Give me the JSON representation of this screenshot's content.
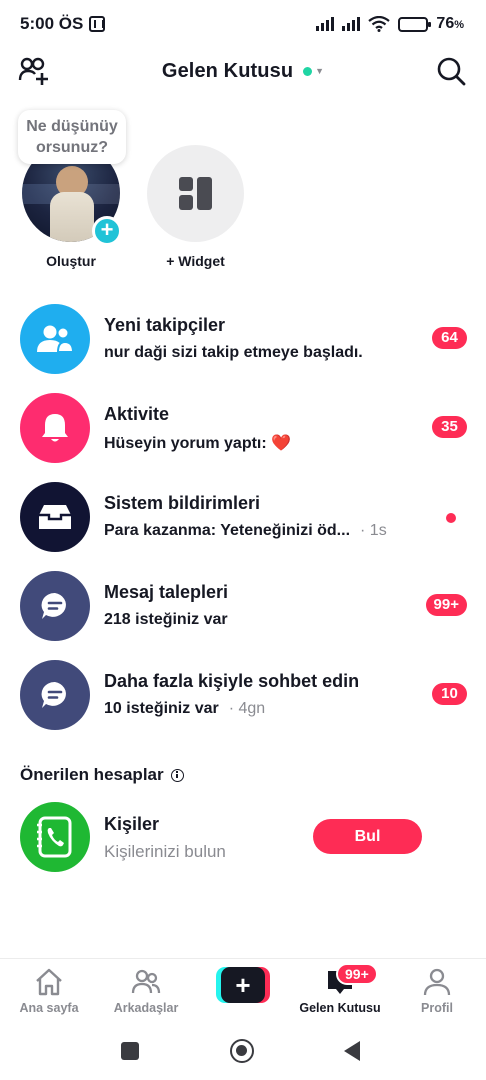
{
  "status_bar": {
    "time": "5:00 ÖS",
    "battery_level": "76",
    "battery_unit": "%",
    "battery_fill": 0.76,
    "battery_color": "#f0b429"
  },
  "header": {
    "title": "Gelen Kutusu",
    "status_color": "#20d5a4",
    "left_icon": "add-friend-icon",
    "right_icon": "search-icon"
  },
  "stories": {
    "bubble_line1": "Ne düşünüy",
    "bubble_line2": "orsunuz?",
    "create_label": "Oluştur",
    "widget_label": "+ Widget",
    "create_badge": "+"
  },
  "inbox": [
    {
      "title": "Yeni takipçiler",
      "subtitle": "nur daği sizi takip etmeye başladı.",
      "time": "",
      "badge": "64",
      "icon": "followers-icon",
      "color": "#1faeef"
    },
    {
      "title": "Aktivite",
      "subtitle": "Hüseyin yorum yaptı: ❤️",
      "time": "",
      "badge": "35",
      "icon": "bell-icon",
      "color": "#fe2c6f"
    },
    {
      "title": "Sistem bildirimleri",
      "subtitle": "Para kazanma: Yeteneğinizi öd...",
      "time": "· 1s",
      "badge": "",
      "icon": "inbox-tray-icon",
      "color": "#111433"
    },
    {
      "title": "Mesaj talepleri",
      "subtitle": "218 isteğiniz var",
      "time": "",
      "badge": "99+",
      "icon": "chat-bubble-icon",
      "color": "#414a7a"
    },
    {
      "title": "Daha fazla kişiyle sohbet edin",
      "subtitle": "10 isteğiniz var",
      "time": "· 4gn",
      "badge": "10",
      "icon": "chat-bubble-icon",
      "color": "#414a7a"
    }
  ],
  "suggested": {
    "heading": "Önerilen hesaplar",
    "contacts_title": "Kişiler",
    "contacts_subtitle": "Kişilerinizi bulun",
    "find_button": "Bul",
    "contacts_color": "#1fb833"
  },
  "bottom_nav": {
    "home": "Ana sayfa",
    "friends": "Arkadaşlar",
    "inbox": "Gelen Kutusu",
    "profile": "Profil",
    "inbox_badge": "99+",
    "create_symbol": "+"
  },
  "colors": {
    "accent": "#fe2c55",
    "text": "#161823",
    "muted": "#8a8b91"
  }
}
